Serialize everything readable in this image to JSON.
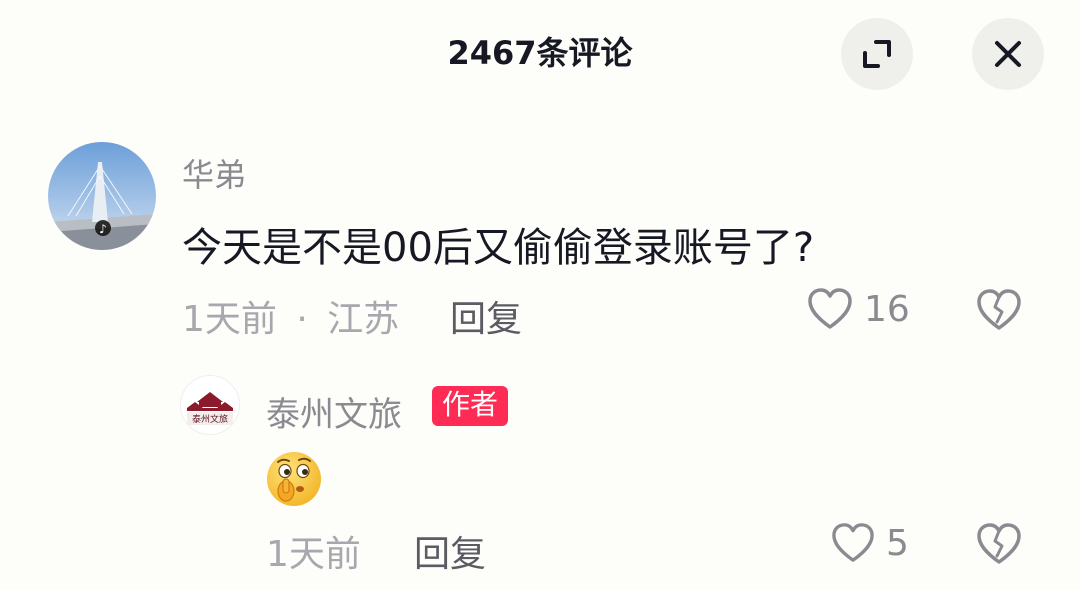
{
  "header": {
    "title": "2467条评论"
  },
  "comments": [
    {
      "username": "华弟",
      "text": "今天是不是00后又偷偷登录账号了?",
      "time": "1天前",
      "separator": "·",
      "location": "江苏",
      "reply_label": "回复",
      "likes": "16"
    },
    {
      "username": "泰州文旅",
      "badge": "作者",
      "avatar_text": "泰州文旅",
      "time": "1天前",
      "reply_label": "回复",
      "likes": "5"
    }
  ],
  "icons": {
    "expand": "expand-icon",
    "close": "close-icon",
    "like": "heart-outline-icon",
    "dislike": "broken-heart-icon",
    "emoji": "shushing-face-emoji"
  },
  "colors": {
    "accent": "#fe2c55",
    "background": "#fdfdfa",
    "button_bg": "#efefec"
  }
}
